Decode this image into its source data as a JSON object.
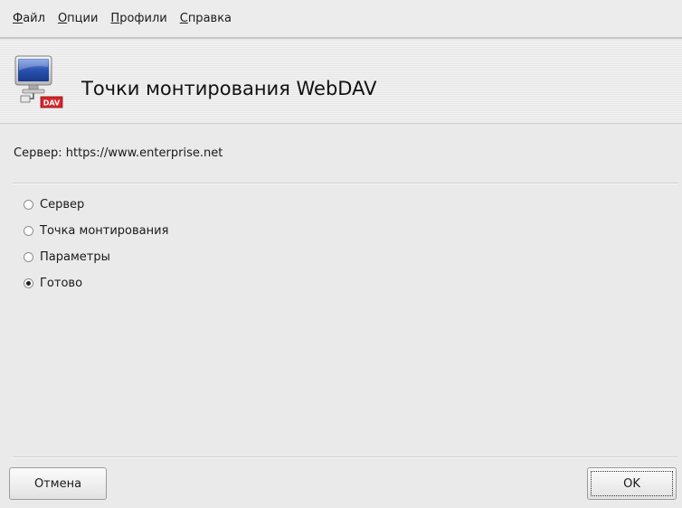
{
  "menu": {
    "items": [
      {
        "accel": "Ф",
        "rest": "айл"
      },
      {
        "accel": "О",
        "rest": "пции"
      },
      {
        "accel": "П",
        "rest": "рофили"
      },
      {
        "accel": "С",
        "rest": "правка"
      }
    ]
  },
  "banner": {
    "title": "Точки монтирования WebDAV",
    "icon": "computer-webdav-icon",
    "icon_badge": "DAV"
  },
  "server": {
    "label": "Сервер: https://www.enterprise.net"
  },
  "options": {
    "items": [
      {
        "label": "Сервер",
        "checked": false
      },
      {
        "label": "Точка монтирования",
        "checked": false
      },
      {
        "label": "Параметры",
        "checked": false
      },
      {
        "label": "Готово",
        "checked": true
      }
    ]
  },
  "buttons": {
    "cancel_label": "Отмена",
    "ok_label": "OK"
  },
  "colors": {
    "badge_red": "#d8242a",
    "screen_blue": "#2a52b0"
  }
}
